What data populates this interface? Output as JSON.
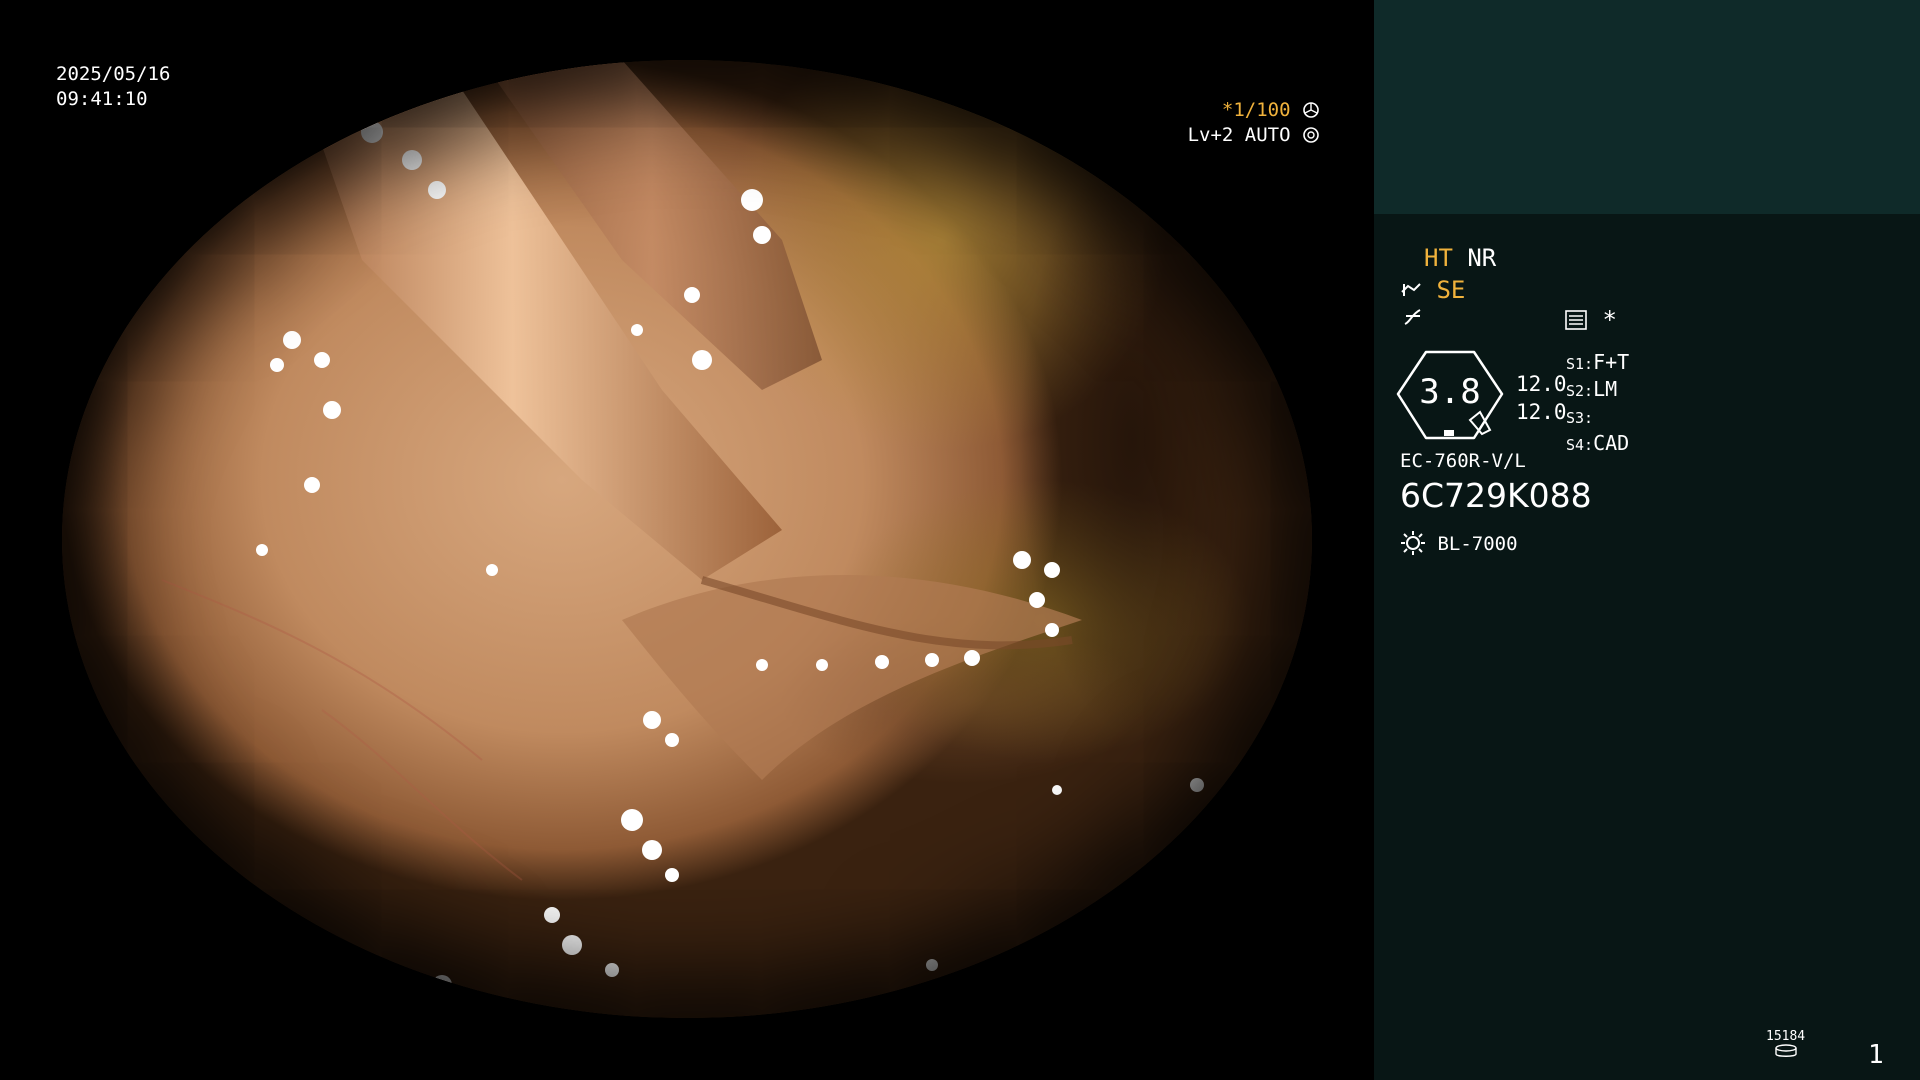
{
  "overlay": {
    "date": "2025/05/16",
    "time": "09:41:10",
    "shutter": "*1/100",
    "level": "Lv+2 AUTO"
  },
  "panel": {
    "modes": {
      "ht": "HT",
      "nr": "NR",
      "se": "SE"
    },
    "structure_mark": "*",
    "zoom_value": "3.8",
    "settings_values": [
      "12.0",
      "12.0"
    ],
    "switches": [
      {
        "key": "S1:",
        "value": "F+T"
      },
      {
        "key": "S2:",
        "value": "LM"
      },
      {
        "key": "S3:",
        "value": ""
      },
      {
        "key": "S4:",
        "value": "CAD"
      }
    ],
    "scope_model": "EC-760R-V/L",
    "serial": "6C729K088",
    "light_source": "BL-7000",
    "counter_small": "15184",
    "page_number": "1"
  },
  "colors": {
    "panel_bg": "#081615",
    "panel_top_bg": "#0f2a29",
    "accent_orange": "#f0b23c"
  },
  "icons": [
    "aperture-icon",
    "auto-iris-icon",
    "scope-icon",
    "graph-icon",
    "menu-icon",
    "gauge-icon",
    "light-source-icon",
    "disk-icon"
  ]
}
